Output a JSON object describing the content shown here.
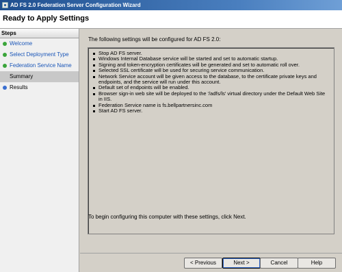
{
  "window": {
    "title": "AD FS 2.0 Federation Server Configuration Wizard"
  },
  "header": {
    "title": "Ready to Apply Settings"
  },
  "steps": {
    "heading": "Steps",
    "items": [
      {
        "label": "Welcome",
        "state": "done"
      },
      {
        "label": "Select Deployment Type",
        "state": "done"
      },
      {
        "label": "Federation Service Name",
        "state": "done"
      },
      {
        "label": "Summary",
        "state": "current"
      },
      {
        "label": "Results",
        "state": "pending"
      }
    ]
  },
  "main": {
    "intro": "The following settings will be configured for AD FS 2.0:",
    "settings": [
      "Stop AD FS server.",
      "Windows Internal Database service will be started and set to automatic startup.",
      "Signing and token-encryption certificates will be generated and set to automatic roll over.",
      "Selected SSL certificate will be used for securing service communication.",
      "Network Service account will be given access to the database, to the certificate private keys and endpoints, and the service will run under this account.",
      "Default set of endpoints will be enabled.",
      "Browser sign-in web site will be deployed to the '/adfs/ls' virtual directory under the Default Web Site in IIS.",
      "Federation Service name is fs.bellpartnersinc.com",
      "Start AD FS server."
    ],
    "footer": "To begin configuring this computer with these settings, click Next."
  },
  "buttons": {
    "previous": "< Previous",
    "next": "Next >",
    "cancel": "Cancel",
    "help": "Help"
  },
  "colors": {
    "title_bar": "#1f4f8f",
    "step_done": "#3aa53a",
    "step_pending": "#3a6fd0",
    "link_text": "#1a56b8"
  }
}
